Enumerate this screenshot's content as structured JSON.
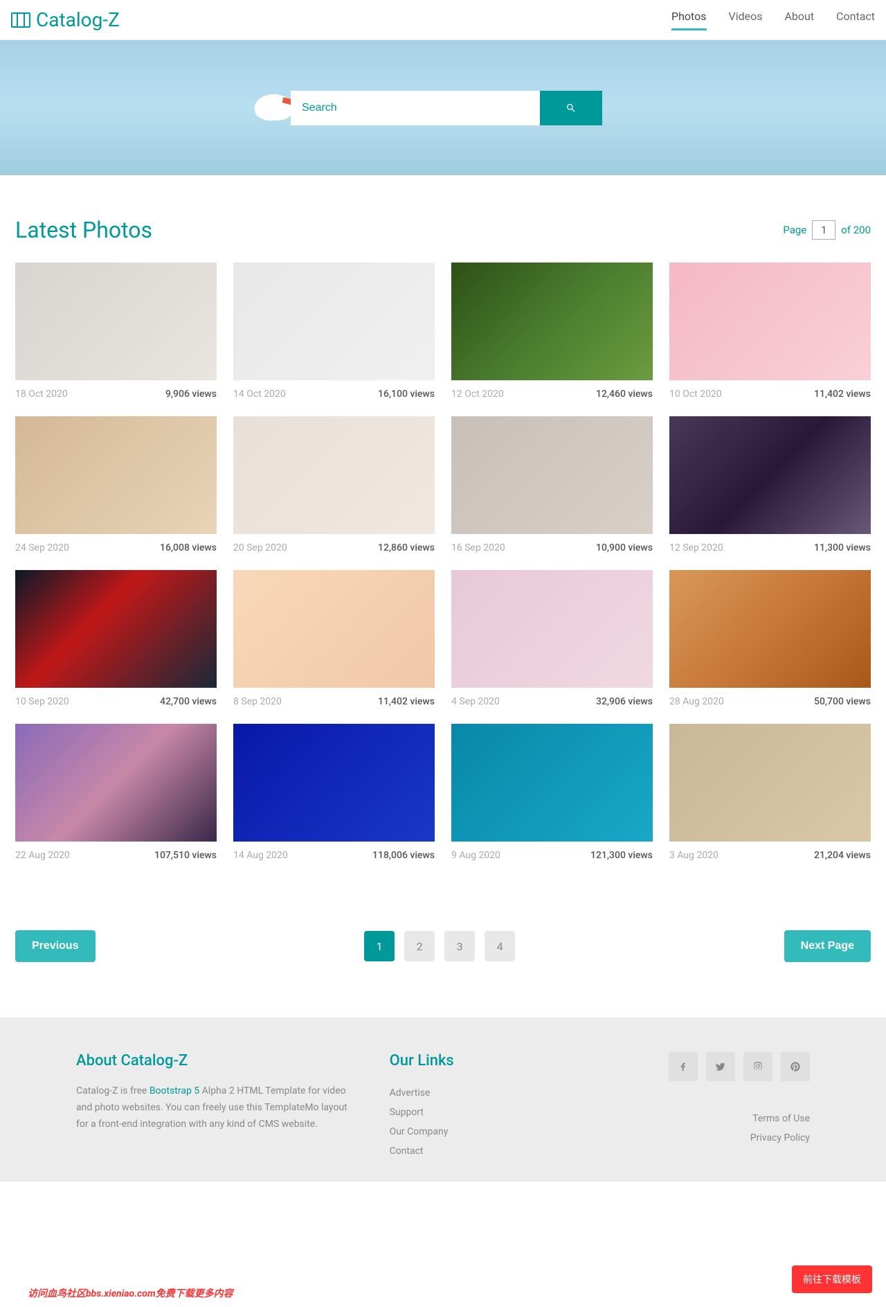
{
  "site": {
    "name": "Catalog-Z"
  },
  "nav": [
    {
      "label": "Photos",
      "active": true
    },
    {
      "label": "Videos",
      "active": false
    },
    {
      "label": "About",
      "active": false
    },
    {
      "label": "Contact",
      "active": false
    }
  ],
  "search": {
    "placeholder": "Search"
  },
  "section": {
    "title": "Latest Photos",
    "page_label": "Page",
    "page_current": "1",
    "page_of": "of 200"
  },
  "photos": [
    {
      "date": "18 Oct 2020",
      "views": "9,906 views",
      "thumb": "t1"
    },
    {
      "date": "14 Oct 2020",
      "views": "16,100 views",
      "thumb": "t2"
    },
    {
      "date": "12 Oct 2020",
      "views": "12,460 views",
      "thumb": "t3"
    },
    {
      "date": "10 Oct 2020",
      "views": "11,402 views",
      "thumb": "t4"
    },
    {
      "date": "24 Sep 2020",
      "views": "16,008 views",
      "thumb": "t5"
    },
    {
      "date": "20 Sep 2020",
      "views": "12,860 views",
      "thumb": "t6"
    },
    {
      "date": "16 Sep 2020",
      "views": "10,900 views",
      "thumb": "t7"
    },
    {
      "date": "12 Sep 2020",
      "views": "11,300 views",
      "thumb": "t8"
    },
    {
      "date": "10 Sep 2020",
      "views": "42,700 views",
      "thumb": "t9"
    },
    {
      "date": "8 Sep 2020",
      "views": "11,402 views",
      "thumb": "t10"
    },
    {
      "date": "4 Sep 2020",
      "views": "32,906 views",
      "thumb": "t11"
    },
    {
      "date": "28 Aug 2020",
      "views": "50,700 views",
      "thumb": "t12"
    },
    {
      "date": "22 Aug 2020",
      "views": "107,510 views",
      "thumb": "t13"
    },
    {
      "date": "14 Aug 2020",
      "views": "118,006 views",
      "thumb": "t14"
    },
    {
      "date": "9 Aug 2020",
      "views": "121,300 views",
      "thumb": "t15"
    },
    {
      "date": "3 Aug 2020",
      "views": "21,204 views",
      "thumb": "t16"
    }
  ],
  "pagination": {
    "prev": "Previous",
    "next": "Next Page",
    "pages": [
      "1",
      "2",
      "3",
      "4"
    ],
    "active": "1"
  },
  "footer": {
    "about_title": "About Catalog-Z",
    "about_text_1": "Catalog-Z is free ",
    "about_link": "Bootstrap 5",
    "about_text_2": " Alpha 2 HTML Template for video and photo websites. You can freely use this TemplateMo layout for a front-end integration with any kind of CMS website.",
    "links_title": "Our Links",
    "links": [
      "Advertise",
      "Support",
      "Our Company",
      "Contact"
    ],
    "legal": [
      "Terms of Use",
      "Privacy Policy"
    ]
  },
  "download_btn": "前往下载模板",
  "watermark": "访问血鸟社区bbs.xieniao.com免费下载更多内容"
}
